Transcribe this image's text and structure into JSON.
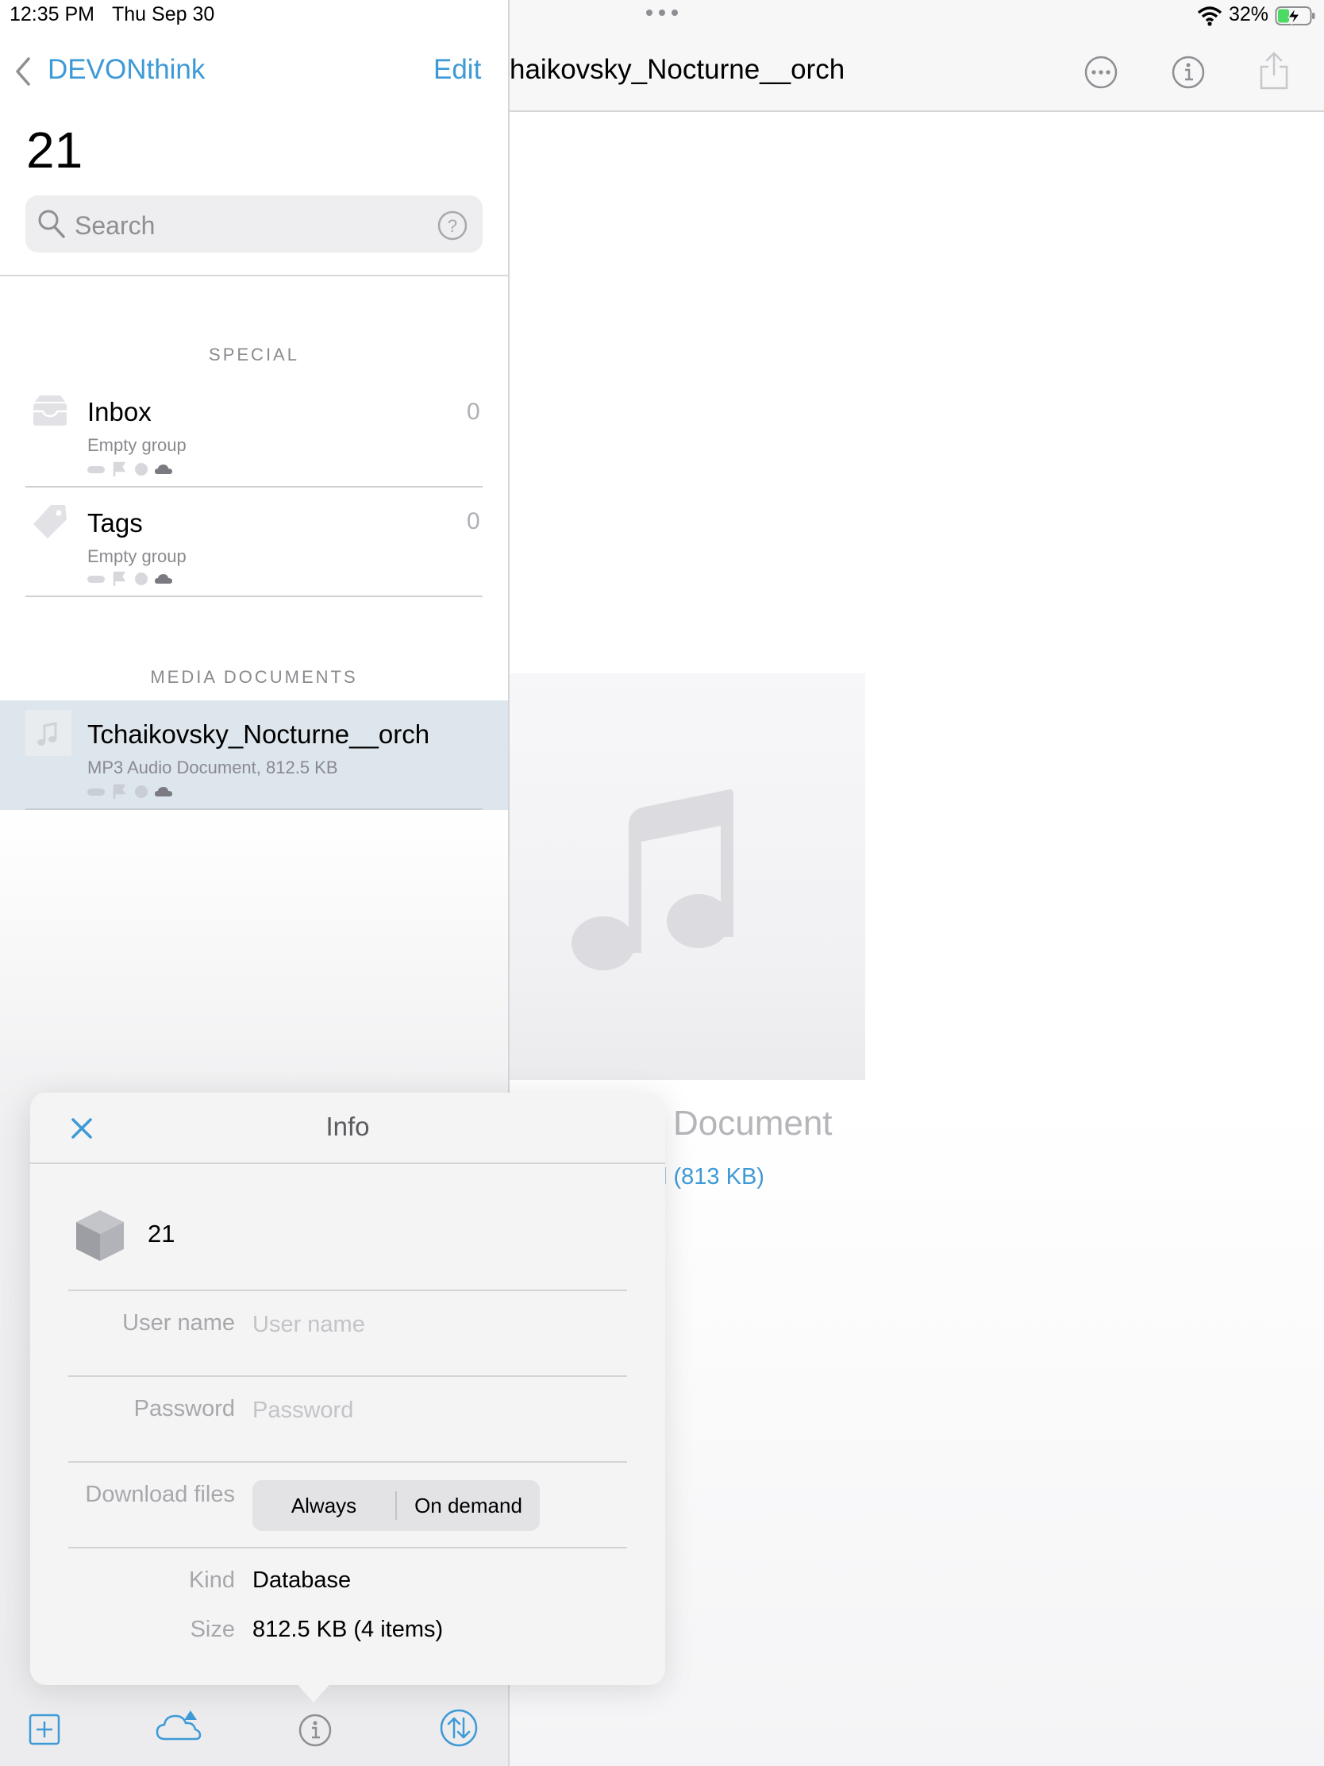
{
  "status_bar": {
    "time": "12:35 PM",
    "date": "Thu Sep 30",
    "battery": "32%"
  },
  "sidebar": {
    "back_label": "DEVONthink",
    "edit_label": "Edit",
    "title": "21",
    "search_placeholder": "Search",
    "sections": {
      "special": "SPECIAL",
      "media": "MEDIA DOCUMENTS"
    },
    "special_items": [
      {
        "title": "Inbox",
        "subtitle": "Empty group",
        "count": "0",
        "icon": "inbox-icon"
      },
      {
        "title": "Tags",
        "subtitle": "Empty group",
        "count": "0",
        "icon": "tag-icon"
      }
    ],
    "media_items": [
      {
        "title": "Tchaikovsky_Nocturne__orch",
        "subtitle": "MP3 Audio Document, 812.5 KB",
        "icon": "music-note-icon"
      }
    ]
  },
  "document": {
    "nav_title": "haikovsky_Nocturne__orch",
    "label": "Document",
    "size_link": "l (813 KB)"
  },
  "info_popover": {
    "title": "Info",
    "database_name": "21",
    "username_label": "User name",
    "username_placeholder": "User name",
    "password_label": "Password",
    "password_placeholder": "Password",
    "download_label": "Download files",
    "download_options": [
      "Always",
      "On demand"
    ],
    "kind_label": "Kind",
    "kind_value": "Database",
    "size_label": "Size",
    "size_value": "812.5 KB (4 items)"
  },
  "colors": {
    "accent": "#3d9ad6",
    "selected_row": "#dde6ed",
    "secondary_text": "#8a8a8f"
  }
}
